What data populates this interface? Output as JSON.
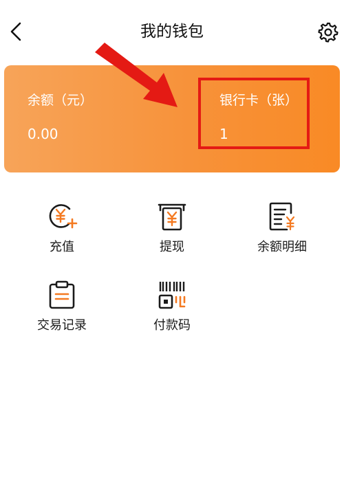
{
  "header": {
    "title": "我的钱包"
  },
  "card": {
    "balance_label": "余额（元）",
    "balance_value": "0.00",
    "bank_card_label": "银行卡（张）",
    "bank_card_value": "1"
  },
  "actions": [
    {
      "label": "充值",
      "icon": "recharge-icon"
    },
    {
      "label": "提现",
      "icon": "withdraw-icon"
    },
    {
      "label": "余额明细",
      "icon": "balance-detail-icon"
    },
    {
      "label": "交易记录",
      "icon": "transaction-record-icon"
    },
    {
      "label": "付款码",
      "icon": "payment-code-icon"
    }
  ],
  "colors": {
    "card_gradient_start": "#f7a459",
    "card_gradient_end": "#f98a25",
    "icon_accent": "#f47920",
    "annotation_red": "#e41a14"
  }
}
